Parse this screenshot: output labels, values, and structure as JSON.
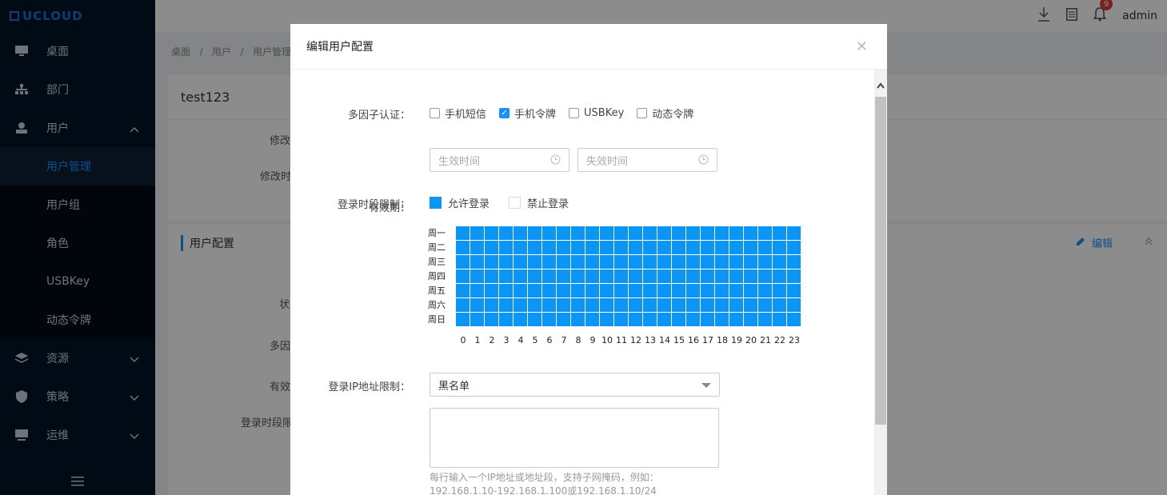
{
  "app": {
    "logo_text": "UCLOUD"
  },
  "sidebar": {
    "items": [
      {
        "label": "桌面",
        "icon": "desktop-icon"
      },
      {
        "label": "部门",
        "icon": "org-tree-icon"
      },
      {
        "label": "用户",
        "icon": "user-icon"
      },
      {
        "label": "资源",
        "icon": "layers-icon"
      },
      {
        "label": "策略",
        "icon": "shield-icon"
      },
      {
        "label": "运维",
        "icon": "monitor-icon"
      }
    ],
    "sub_items": [
      "用户管理",
      "用户组",
      "角色",
      "USBKey",
      "动态令牌"
    ]
  },
  "topbar": {
    "user": "admin",
    "notification_count": "9"
  },
  "breadcrumb": {
    "items": [
      "桌面",
      "用户",
      "用户管理"
    ]
  },
  "page": {
    "username": "test123",
    "info_labels": [
      "修改",
      "修改时"
    ],
    "config_title": "用户配置",
    "edit_label": "编辑",
    "config_labels": [
      "状",
      "多因",
      "有效",
      "登录时段限"
    ]
  },
  "modal": {
    "title": "编辑用户配置",
    "mfa": {
      "label": "多因子认证：",
      "options": [
        {
          "label": "手机短信",
          "checked": false
        },
        {
          "label": "手机令牌",
          "checked": true
        },
        {
          "label": "USBKey",
          "checked": false
        },
        {
          "label": "动态令牌",
          "checked": false
        }
      ]
    },
    "validity": {
      "label": "有效期：",
      "start_placeholder": "生效时间",
      "end_placeholder": "失效时间"
    },
    "login_time": {
      "label": "登录时段限制：",
      "allow_label": "允许登录",
      "deny_label": "禁止登录",
      "days": [
        "周一",
        "周二",
        "周三",
        "周四",
        "周五",
        "周六",
        "周日"
      ],
      "hours": [
        "0",
        "1",
        "2",
        "3",
        "4",
        "5",
        "6",
        "7",
        "8",
        "9",
        "10",
        "11",
        "12",
        "13",
        "14",
        "15",
        "16",
        "17",
        "18",
        "19",
        "20",
        "21",
        "22",
        "23"
      ],
      "allowed_color": "#0b96f5"
    },
    "ip": {
      "label": "登录IP地址限制：",
      "mode": "黑名单",
      "hint": "每行输入一个IP地址或地址段，支持子网掩码，例如：192.168.1.10-192.168.1.100或192.168.1.10/24"
    }
  }
}
